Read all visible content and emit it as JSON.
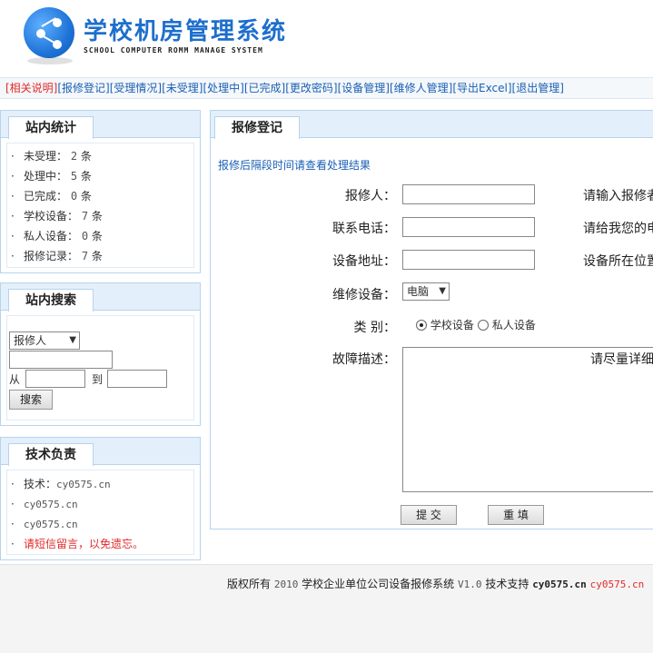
{
  "header": {
    "title": "学校机房管理系统",
    "subtitle": "SCHOOL COMPUTER ROMM MANAGE SYSTEM"
  },
  "nav": {
    "items": [
      "[相关说明]",
      "[报修登记]",
      "[受理情况]",
      "[未受理]",
      "[处理中]",
      "[已完成]",
      "[更改密码]",
      "[设备管理]",
      "[维修人管理]",
      "[导出Excel]",
      "[退出管理]"
    ]
  },
  "stats": {
    "title": "站内统计",
    "items": [
      {
        "label": "未受理：",
        "value": "2",
        "unit": "条"
      },
      {
        "label": "处理中：",
        "value": "5",
        "unit": "条"
      },
      {
        "label": "已完成：",
        "value": "0",
        "unit": "条"
      },
      {
        "label": "学校设备：",
        "value": "7",
        "unit": "条"
      },
      {
        "label": "私人设备：",
        "value": "0",
        "unit": "条"
      },
      {
        "label": "报修记录：",
        "value": "7",
        "unit": "条"
      }
    ]
  },
  "search": {
    "title": "站内搜索",
    "field_select": "报修人",
    "from_label": "从",
    "to_label": "到",
    "button": "搜索"
  },
  "tech": {
    "title": "技术负责",
    "line1_label": "技术：",
    "line1_value": "cy0575.cn",
    "line2": "cy0575.cn",
    "line3": "cy0575.cn",
    "line4": "请短信留言，以免遗忘。"
  },
  "form": {
    "tab_title": "报修登记",
    "note": "报修后隔段时间请查看处理结果",
    "reporter_label": "报修人：",
    "reporter_hint": "请输入报修者",
    "phone_label": "联系电话：",
    "phone_hint": "请给我您的电",
    "address_label": "设备地址：",
    "address_hint": "设备所在位置",
    "device_label": "维修设备：",
    "device_selected": "电脑",
    "type_label": "类  别：",
    "type_option1": "学校设备",
    "type_option2": "私人设备",
    "fault_label": "故障描述：",
    "fault_hint": "请尽量详细",
    "submit": "提  交",
    "reset": "重  填"
  },
  "footer": {
    "copyright": "版权所有",
    "year": "2010",
    "system_name": "学校企业单位公司设备报修系统",
    "version": "V1.0",
    "support_label": "技术支持",
    "support_bold": "cy0575.cn",
    "support_link": "cy0575.cn"
  },
  "colors": {
    "brand": "#1e6fcc",
    "link": "#1a5fb4",
    "alert": "#e12a2a",
    "panel_border": "#b7d3ee",
    "panel_head": "#e3effa"
  }
}
